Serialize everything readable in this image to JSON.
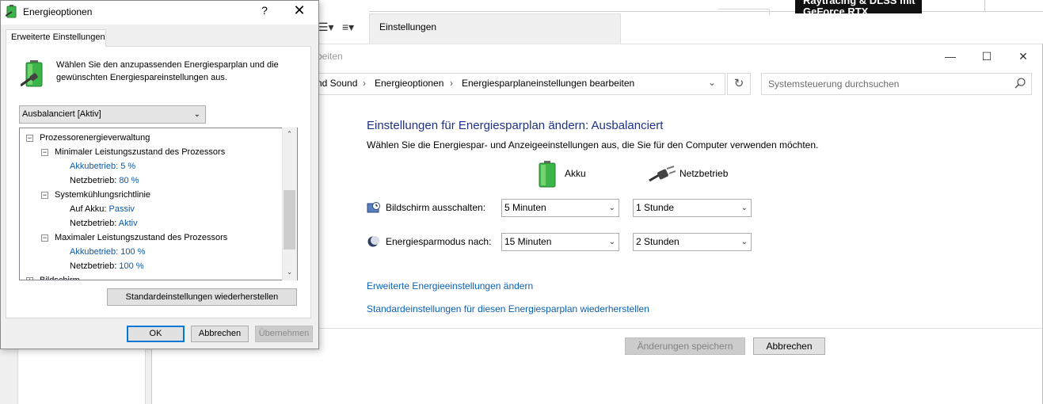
{
  "background": {
    "tab_label": "Einstellungen",
    "ad_text": "Raytracing & DLSS mit GeForce RTX"
  },
  "control_panel": {
    "title_fragment": "beiten",
    "breadcrumb": [
      "nd Sound",
      "Energieoptionen",
      "Energiesparplaneinstellungen bearbeiten"
    ],
    "search_placeholder": "Systemsteuerung durchsuchen",
    "heading": "Einstellungen für Energiesparplan ändern: Ausbalanciert",
    "subheading": "Wählen Sie die Energiespar- und Anzeigeeinstellungen aus, die Sie für den Computer verwenden möchten.",
    "column_battery": "Akku",
    "column_plugged": "Netzbetrieb",
    "rows": [
      {
        "label": "Bildschirm ausschalten:",
        "battery": "5 Minuten",
        "plugged": "1 Stunde"
      },
      {
        "label": "Energiesparmodus nach:",
        "battery": "15 Minuten",
        "plugged": "2 Stunden"
      }
    ],
    "link_advanced": "Erweiterte Energieeinstellungen ändern",
    "link_restore": "Standardeinstellungen für diesen Energiesparplan wiederherstellen",
    "save_button": "Änderungen speichern",
    "cancel_button": "Abbrechen"
  },
  "dialog": {
    "title": "Energieoptionen",
    "help_glyph": "?",
    "close_glyph": "✕",
    "tab": "Erweiterte Einstellungen",
    "description": "Wählen Sie den anzupassenden Energiesparplan und die gewünschten Energiespareinstellungen aus.",
    "plan_selected": "Ausbalanciert [Aktiv]",
    "tree": [
      {
        "text": "Prozessorenergieverwaltung",
        "level": 0,
        "expander": "−"
      },
      {
        "text": "Minimaler Leistungszustand des Prozessors",
        "level": 1,
        "expander": "−"
      },
      {
        "key": "Akkubetrieb:",
        "value": "5 %",
        "level": 2,
        "link_key": true
      },
      {
        "key": "Netzbetrieb:",
        "value": "80 %",
        "level": 2,
        "link_key": false
      },
      {
        "text": "Systemkühlungsrichtlinie",
        "level": 1,
        "expander": "−"
      },
      {
        "key": "Auf Akku:",
        "value": "Passiv",
        "level": 2,
        "link_key": false
      },
      {
        "key": "Netzbetrieb:",
        "value": "Aktiv",
        "level": 2,
        "link_key": false
      },
      {
        "text": "Maximaler Leistungszustand des Prozessors",
        "level": 1,
        "expander": "−"
      },
      {
        "key": "Akkubetrieb:",
        "value": "100 %",
        "level": 2,
        "link_key": true
      },
      {
        "key": "Netzbetrieb:",
        "value": "100 %",
        "level": 2,
        "link_key": false
      },
      {
        "text": "Bildschirm",
        "level": 0,
        "expander": "+"
      }
    ],
    "restore_button": "Standardeinstellungen wiederherstellen",
    "ok_button": "OK",
    "cancel_button": "Abbrechen",
    "apply_button": "Übernehmen"
  }
}
